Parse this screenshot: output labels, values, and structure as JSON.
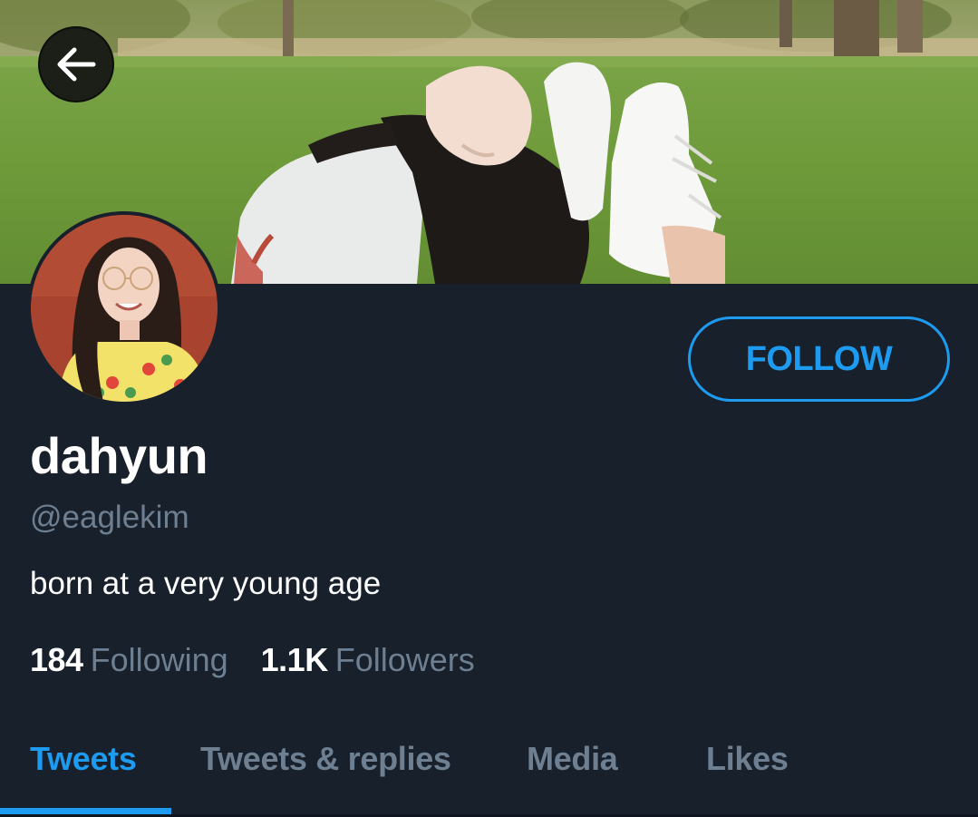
{
  "profile": {
    "display_name": "dahyun",
    "handle": "@eaglekim",
    "bio": "born at a very young age"
  },
  "actions": {
    "follow_label": "FOLLOW"
  },
  "stats": {
    "following_count": "184",
    "following_label": "Following",
    "followers_count": "1.1K",
    "followers_label": "Followers"
  },
  "tabs": [
    {
      "label": "Tweets",
      "active": true
    },
    {
      "label": "Tweets & replies",
      "active": false
    },
    {
      "label": "Media",
      "active": false
    },
    {
      "label": "Likes",
      "active": false
    }
  ],
  "icons": {
    "back": "back-arrow-icon"
  },
  "colors": {
    "background": "#17202b",
    "accent": "#1d9bf0",
    "secondary_text": "#6d7f90",
    "primary_text": "#ffffff"
  }
}
